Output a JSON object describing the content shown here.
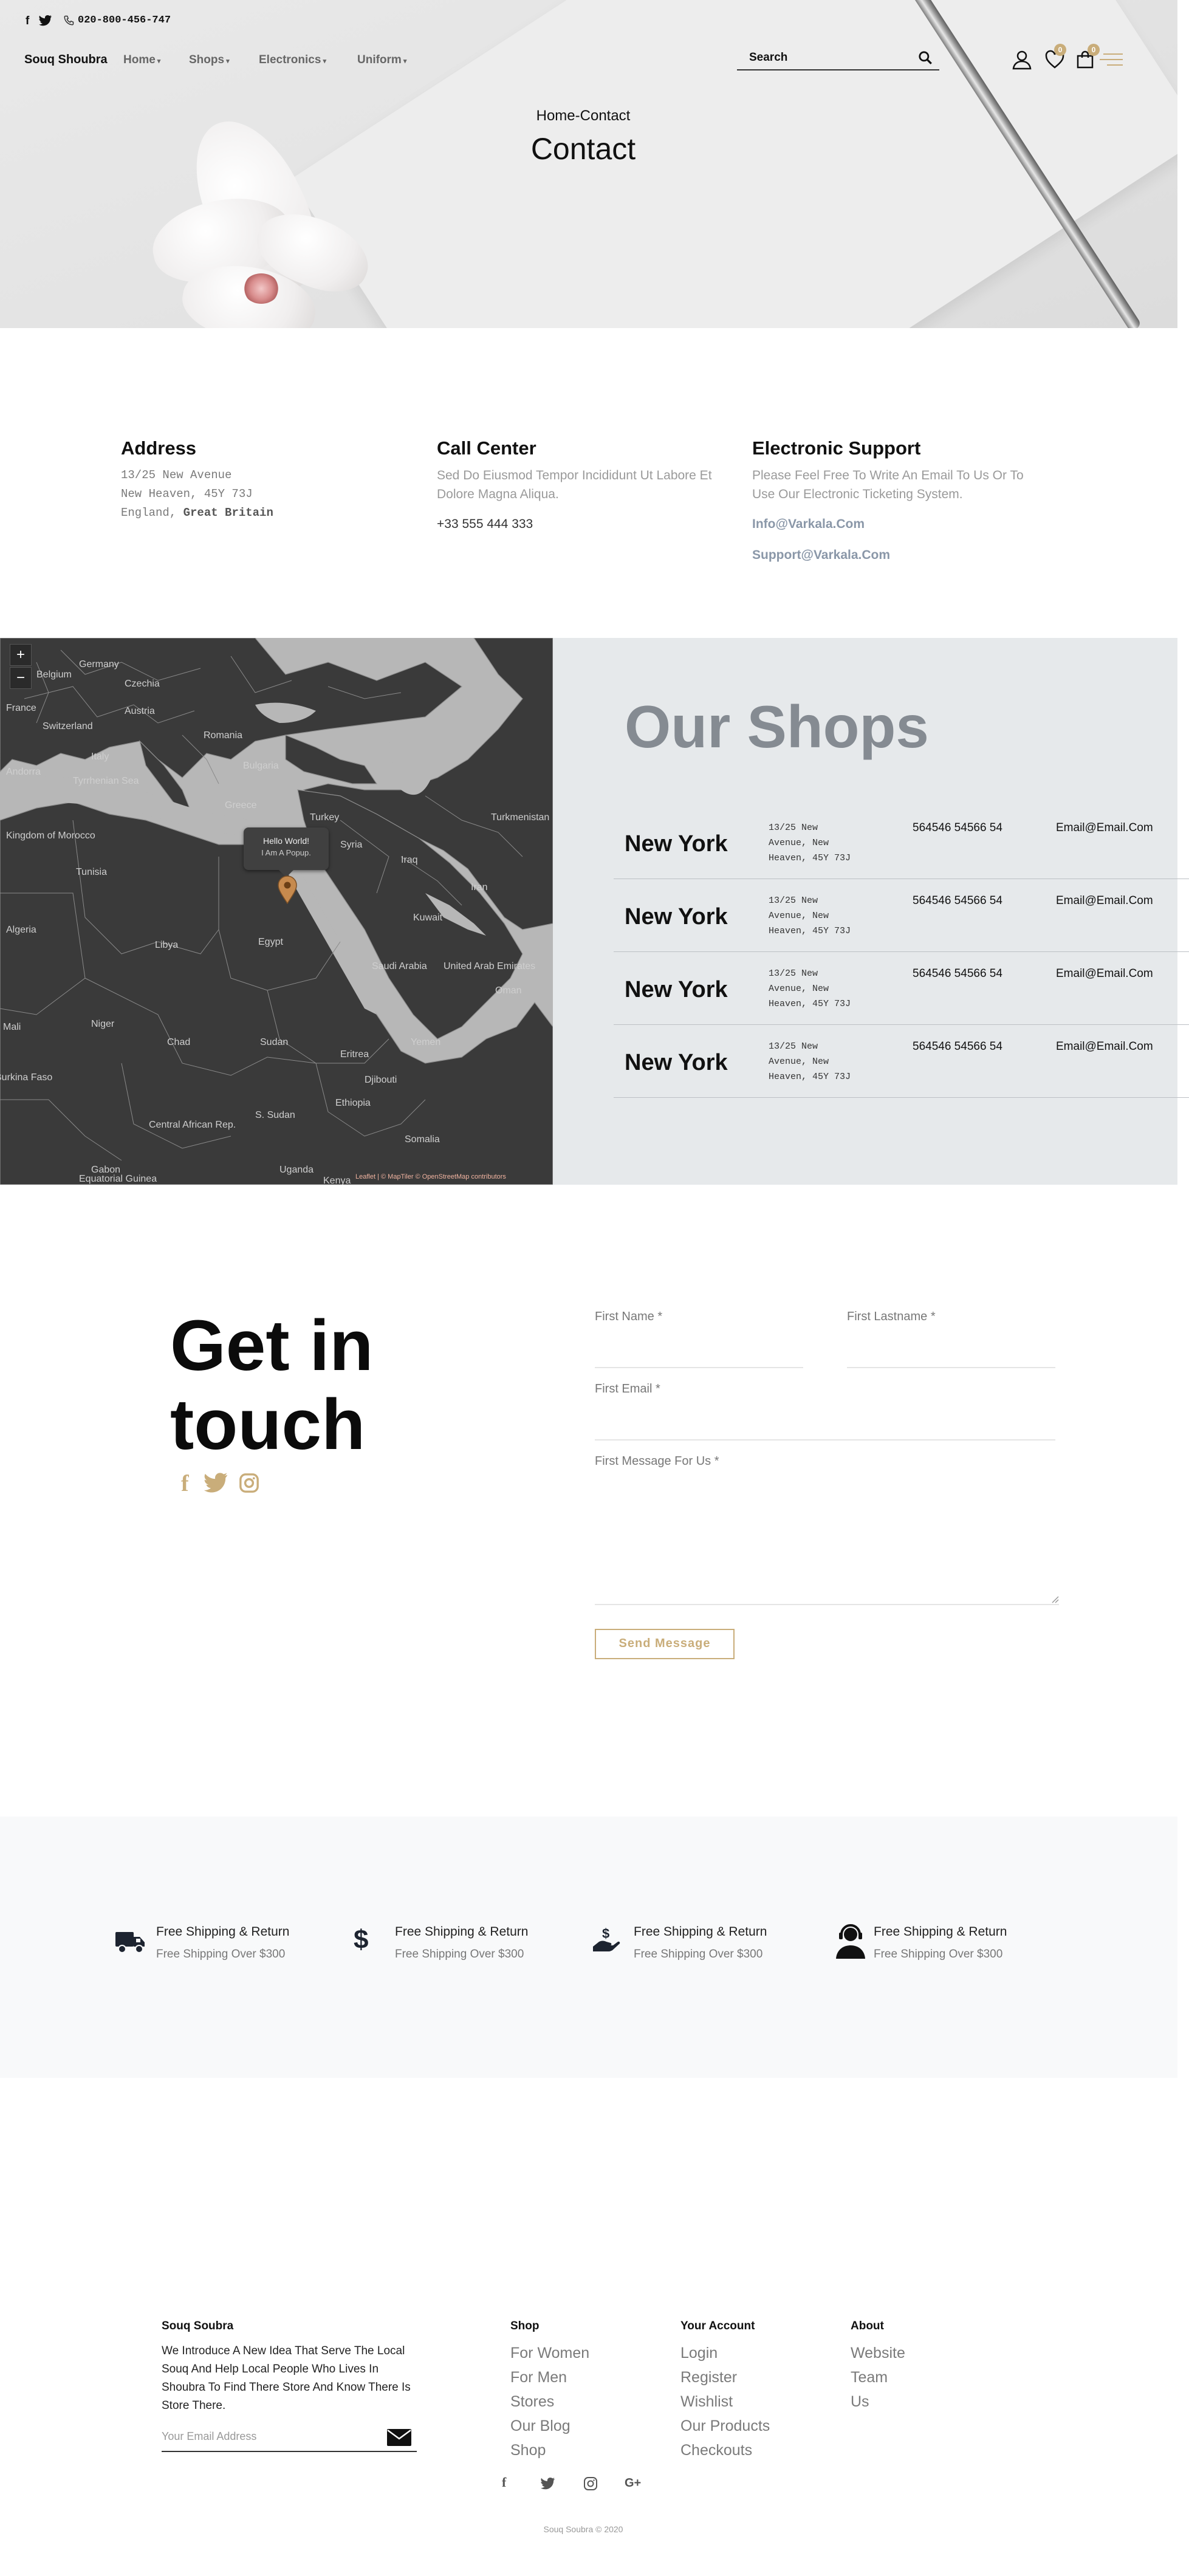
{
  "topbar": {
    "phone": "020-800-456-747"
  },
  "nav": {
    "brand": "Souq Shoubra",
    "items": [
      "Home",
      "Shops",
      "Electronics",
      "Uniform"
    ],
    "search_placeholder": "Search",
    "wishlist_count": "0",
    "cart_count": "0"
  },
  "hero": {
    "breadcrumb": "Home-Contact",
    "title": "Contact"
  },
  "info": {
    "address": {
      "heading": "Address",
      "line1": "13/25 New Avenue",
      "line2": "New Heaven, 45Y 73J",
      "line3_prefix": "England, ",
      "line3_bold": "Great Britain"
    },
    "call": {
      "heading": "Call Center",
      "text1": "Sed Do Eiusmod Tempor Incididunt Ut Labore Et",
      "text2": "Dolore Magna Aliqua.",
      "phone": "+33 555 444 333"
    },
    "support": {
      "heading": "Electronic Support",
      "text1": "Please Feel Free To Write An Email To Us Or To",
      "text2": "Use Our Electronic Ticketing System.",
      "email1": "Info@Varkala.Com",
      "email2": "Support@Varkala.Com"
    }
  },
  "map": {
    "zoom_in": "+",
    "zoom_out": "−",
    "popup_title": "Hello World!",
    "popup_text": "I Am A Popup.",
    "attribution": "Leaflet | © MapTiler © OpenStreetMap contributors",
    "labels": [
      "Belgium",
      "Germany",
      "Czechia",
      "Austria",
      "Switzerland",
      "France",
      "Italy",
      "Romania",
      "Bulgaria",
      "Greece",
      "Turkey",
      "Syria",
      "Iraq",
      "Iran",
      "Turkmenistan",
      "Tunisia",
      "Algeria",
      "Libya",
      "Egypt",
      "Saudi Arabia",
      "Kuwait",
      "United Arab Emirates",
      "Oman",
      "Yemen",
      "Mali",
      "Niger",
      "Chad",
      "Sudan",
      "Eritrea",
      "Ethiopia",
      "Djibouti",
      "Somalia",
      "S. Sudan",
      "Central African Rep.",
      "Uganda",
      "Kenya",
      "Gabon",
      "Equatorial Guinea",
      "Burkina Faso",
      "Andorra",
      "Tyrrhenian Sea",
      "Kingdom of Morocco"
    ]
  },
  "shops": {
    "title": "Our Shops",
    "rows": [
      {
        "city": "New York",
        "addr1": "13/25 New",
        "addr2": "Avenue, New",
        "addr3": "Heaven, 45Y 73J",
        "phone": "564546 54566 54",
        "email": "Email@Email.Com"
      },
      {
        "city": "New York",
        "addr1": "13/25 New",
        "addr2": "Avenue, New",
        "addr3": "Heaven, 45Y 73J",
        "phone": "564546 54566 54",
        "email": "Email@Email.Com"
      },
      {
        "city": "New York",
        "addr1": "13/25 New",
        "addr2": "Avenue, New",
        "addr3": "Heaven, 45Y 73J",
        "phone": "564546 54566 54",
        "email": "Email@Email.Com"
      },
      {
        "city": "New York",
        "addr1": "13/25 New",
        "addr2": "Avenue, New",
        "addr3": "Heaven, 45Y 73J",
        "phone": "564546 54566 54",
        "email": "Email@Email.Com"
      }
    ]
  },
  "contact": {
    "heading_line1": "Get in",
    "heading_line2": "touch",
    "first_name": "First Name *",
    "last_name": "First Lastname *",
    "email": "First Email *",
    "message": "First Message For Us *",
    "send": "Send Message"
  },
  "features": [
    {
      "icon": "truck-icon",
      "title": "Free Shipping & Return",
      "sub": "Free Shipping Over $300"
    },
    {
      "icon": "dollar-icon",
      "title": "Free Shipping & Return",
      "sub": "Free Shipping Over $300"
    },
    {
      "icon": "hand-money-icon",
      "title": "Free Shipping & Return",
      "sub": "Free Shipping Over $300"
    },
    {
      "icon": "headset-user-icon",
      "title": "Free Shipping & Return",
      "sub": "Free Shipping Over $300"
    }
  ],
  "footer": {
    "brand": "Souq Soubra",
    "about_l1": "We Introduce A New Idea That Serve The Local",
    "about_l2": "Souq And Help Local People Who Lives In",
    "about_l3": "Shoubra To Find There Store And Know There Is",
    "about_l4": "Store There.",
    "email_placeholder": "Your Email Address",
    "shop": {
      "heading": "Shop",
      "links": [
        "For Women",
        "For Men",
        "Stores",
        "Our Blog",
        "Shop"
      ]
    },
    "account": {
      "heading": "Your Account",
      "links": [
        "Login",
        "Register",
        "Wishlist",
        "Our Products",
        "Checkouts"
      ]
    },
    "about": {
      "heading": "About",
      "links": [
        "Website",
        "Team",
        "Us"
      ]
    },
    "social": [
      "facebook-icon",
      "twitter-icon",
      "instagram-icon",
      "google-plus-icon"
    ],
    "social_gplus_text": "G+",
    "copyright": "Souq Soubra © 2020"
  },
  "colors": {
    "accent": "#c9ad7a",
    "shops_bg": "#e6e9eb",
    "shops_title": "#858b92",
    "map_land": "#3a3a3a",
    "map_sea": "#b7b7b7",
    "link": "#8a97a8"
  }
}
